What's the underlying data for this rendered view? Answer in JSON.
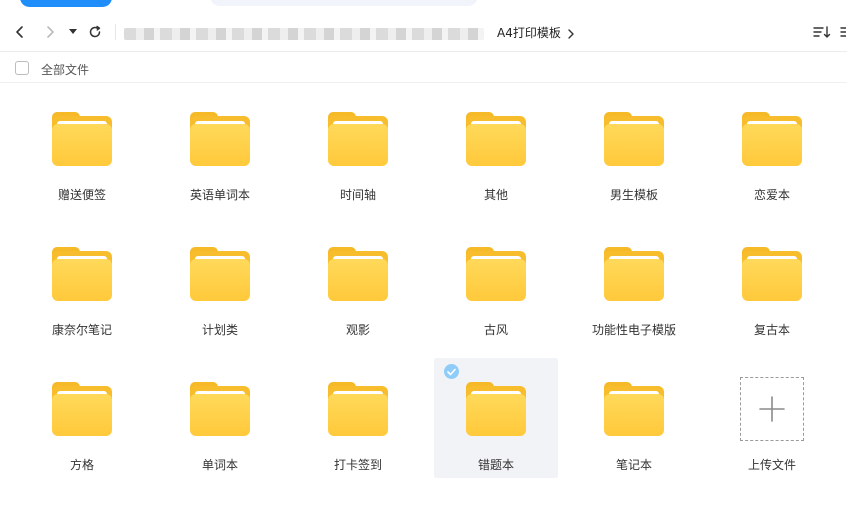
{
  "breadcrumb": {
    "current": "A4打印模板"
  },
  "selectbar": {
    "select_all_label": "全部文件"
  },
  "folders": [
    {
      "name": "赠送便签"
    },
    {
      "name": "英语单词本"
    },
    {
      "name": "时间轴"
    },
    {
      "name": "其他"
    },
    {
      "name": "男生模板"
    },
    {
      "name": "恋爱本"
    },
    {
      "name": "康奈尔笔记"
    },
    {
      "name": "计划类"
    },
    {
      "name": "观影"
    },
    {
      "name": "古风"
    },
    {
      "name": "功能性电子模版"
    },
    {
      "name": "复古本"
    },
    {
      "name": "方格"
    },
    {
      "name": "单词本"
    },
    {
      "name": "打卡签到"
    },
    {
      "name": "错题本",
      "selected": true
    },
    {
      "name": "笔记本"
    }
  ],
  "upload": {
    "label": "上传文件"
  },
  "colors": {
    "folder_front": "#ffc93b",
    "folder_back": "#f8bd2c",
    "selection_bg": "#f2f3f6",
    "check_badge": "#8fcdf8",
    "primary_blue": "#1f8efa"
  },
  "icons": {
    "back": "chevron-left-icon",
    "forward": "chevron-right-icon",
    "history": "caret-down-icon",
    "refresh": "refresh-icon",
    "sort": "sort-icon",
    "more": "more-icon",
    "upload": "plus-icon",
    "folder": "folder-icon"
  }
}
